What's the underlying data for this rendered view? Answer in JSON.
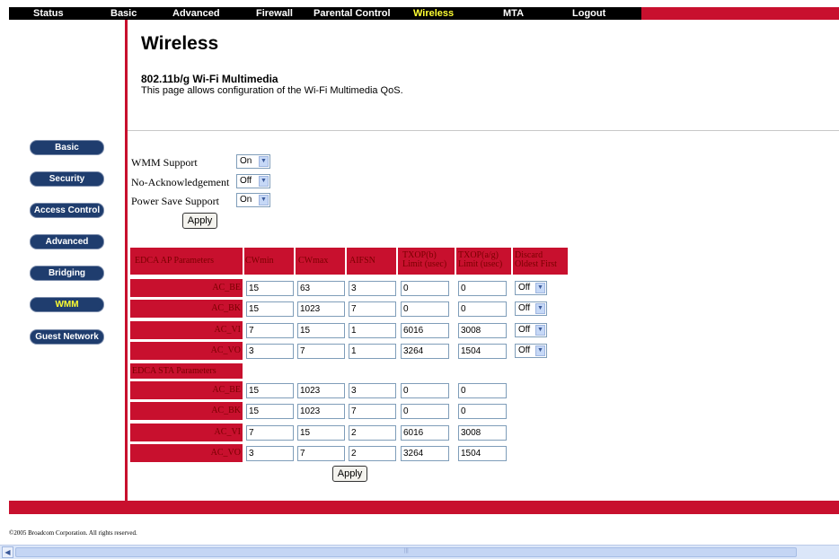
{
  "nav": {
    "items": [
      {
        "label": "Status",
        "active": false
      },
      {
        "label": "Basic",
        "active": false
      },
      {
        "label": "Advanced",
        "active": false
      },
      {
        "label": "Firewall",
        "active": false
      },
      {
        "label": "Parental Control",
        "active": false
      },
      {
        "label": "Wireless",
        "active": true
      },
      {
        "label": "MTA",
        "active": false
      },
      {
        "label": "Logout",
        "active": false
      }
    ],
    "accent_color": "#c8102e",
    "active_color": "#ffff33"
  },
  "header": {
    "title": "Wireless",
    "subtitle": "802.11b/g Wi-Fi Multimedia",
    "description": "This page allows configuration of the Wi-Fi Multimedia QoS."
  },
  "sidebar": {
    "items": [
      {
        "label": "Basic",
        "active": false
      },
      {
        "label": "Security",
        "active": false
      },
      {
        "label": "Access Control",
        "active": false
      },
      {
        "label": "Advanced",
        "active": false
      },
      {
        "label": "Bridging",
        "active": false
      },
      {
        "label": "WMM",
        "active": true
      },
      {
        "label": "Guest Network",
        "active": false
      }
    ]
  },
  "settings": {
    "wmm_support": {
      "label": "WMM Support",
      "value": "On"
    },
    "no_ack": {
      "label": "No-Acknowledgement",
      "value": "Off"
    },
    "power_save": {
      "label": "Power Save Support",
      "value": "On"
    },
    "apply_label": "Apply"
  },
  "edca": {
    "headers": [
      "EDCA AP Parameters",
      "CWmin",
      "CWmax",
      "AIFSN",
      "TXOP(b) Limit (usec)",
      "TXOP(a/g) Limit (usec)",
      "Discard Oldest First"
    ],
    "ap_rows": [
      {
        "label": "AC_BE",
        "cwmin": "15",
        "cwmax": "63",
        "aifsn": "3",
        "txop_b": "0",
        "txop_ag": "0",
        "discard": "Off"
      },
      {
        "label": "AC_BK",
        "cwmin": "15",
        "cwmax": "1023",
        "aifsn": "7",
        "txop_b": "0",
        "txop_ag": "0",
        "discard": "Off"
      },
      {
        "label": "AC_VI",
        "cwmin": "7",
        "cwmax": "15",
        "aifsn": "1",
        "txop_b": "6016",
        "txop_ag": "3008",
        "discard": "Off"
      },
      {
        "label": "AC_VO",
        "cwmin": "3",
        "cwmax": "7",
        "aifsn": "1",
        "txop_b": "3264",
        "txop_ag": "1504",
        "discard": "Off"
      }
    ],
    "sta_header": "EDCA STA Parameters",
    "sta_rows": [
      {
        "label": "AC_BE",
        "cwmin": "15",
        "cwmax": "1023",
        "aifsn": "3",
        "txop_b": "0",
        "txop_ag": "0"
      },
      {
        "label": "AC_BK",
        "cwmin": "15",
        "cwmax": "1023",
        "aifsn": "7",
        "txop_b": "0",
        "txop_ag": "0"
      },
      {
        "label": "AC_VI",
        "cwmin": "7",
        "cwmax": "15",
        "aifsn": "2",
        "txop_b": "6016",
        "txop_ag": "3008"
      },
      {
        "label": "AC_VO",
        "cwmin": "3",
        "cwmax": "7",
        "aifsn": "2",
        "txop_b": "3264",
        "txop_ag": "1504"
      }
    ],
    "apply_label": "Apply"
  },
  "footer": {
    "copyright": "©2005 Broadcom Corporation. All rights reserved."
  }
}
